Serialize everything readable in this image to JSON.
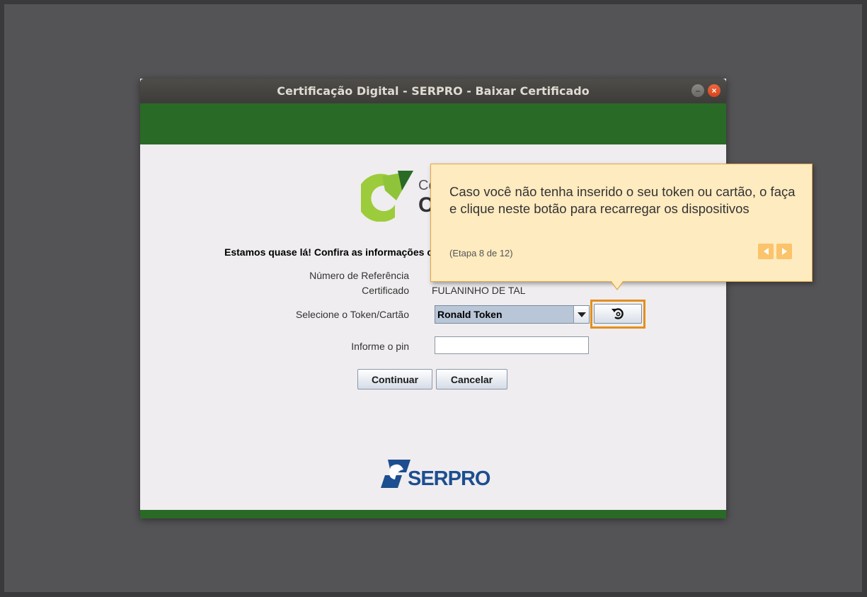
{
  "window": {
    "title": "Certificação Digital - SERPRO - Baixar Certificado",
    "minimize_glyph": "–",
    "close_glyph": "×"
  },
  "logo": {
    "text_line1": "Ce",
    "text_line2": "C"
  },
  "form": {
    "headline": "Estamos quase lá! Confira as informações c",
    "reference_label": "Número de Referência",
    "certificate_label": "Certificado",
    "certificate_value": "FULANINHO DE TAL",
    "token_label": "Selecione o Token/Cartão",
    "token_selected": "Ronald Token",
    "pin_label": "Informe o pin",
    "pin_value": "",
    "continue_label": "Continuar",
    "cancel_label": "Cancelar"
  },
  "brand": {
    "serpro_text": "SERPRO"
  },
  "tooltip": {
    "message": "Caso você não tenha inserido o seu token ou cartão, o faça e clique neste botão para recarregar os dispositivos",
    "step": "(Etapa 8 de 12)"
  },
  "icons": {
    "refresh": "refresh-icon",
    "dropdown": "chevron-down-icon",
    "prev": "arrow-left-icon",
    "next": "arrow-right-icon"
  },
  "colors": {
    "green_band": "#2a6a27",
    "tooltip_bg": "#feebc0",
    "highlight_outline": "#e38f1e",
    "serpro_blue": "#1d4e8f",
    "logo_lime": "#9ccc3c"
  }
}
